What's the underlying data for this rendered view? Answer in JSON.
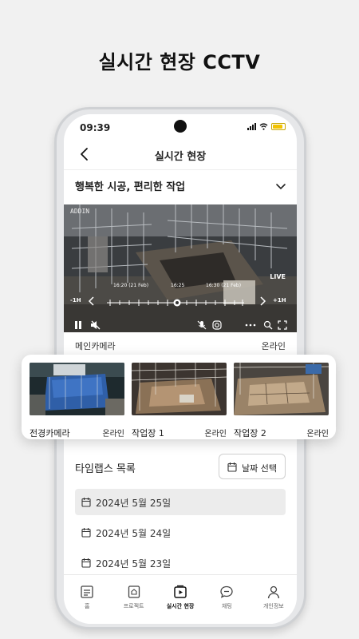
{
  "headline": "실시간 현장 CCTV",
  "status": {
    "time": "09:39"
  },
  "appbar": {
    "title": "실시간 현장"
  },
  "site": {
    "name": "행복한 시공, 편리한 작업"
  },
  "player": {
    "timeline_labels": [
      "16:20 (21 Feb)",
      "16:25",
      "16:30 (21 Feb)"
    ],
    "minus": "-1H",
    "plus": "+1H",
    "live": "LIVE",
    "overlay_badge": "ADDIN"
  },
  "main_camera": {
    "name": "메인카메라",
    "status": "온라인"
  },
  "cameras": [
    {
      "name": "전경카메라",
      "status": "온라인"
    },
    {
      "name": "작업장 1",
      "status": "온라인"
    },
    {
      "name": "작업장 2",
      "status": "온라인"
    }
  ],
  "timelapse": {
    "title": "타임랩스 목록",
    "date_button": "날짜 선택",
    "dates": [
      "2024년 5월 25일",
      "2024년 5월 24일",
      "2024년 5월 23일"
    ]
  },
  "nav": [
    {
      "label": "홈",
      "icon": "home-icon"
    },
    {
      "label": "프로젝트",
      "icon": "project-icon"
    },
    {
      "label": "실시간 현장",
      "icon": "live-video-icon"
    },
    {
      "label": "채팅",
      "icon": "chat-icon"
    },
    {
      "label": "개인정보",
      "icon": "person-icon"
    }
  ],
  "colors": {
    "battery": "#f2c200",
    "active_row": "#ececec"
  }
}
